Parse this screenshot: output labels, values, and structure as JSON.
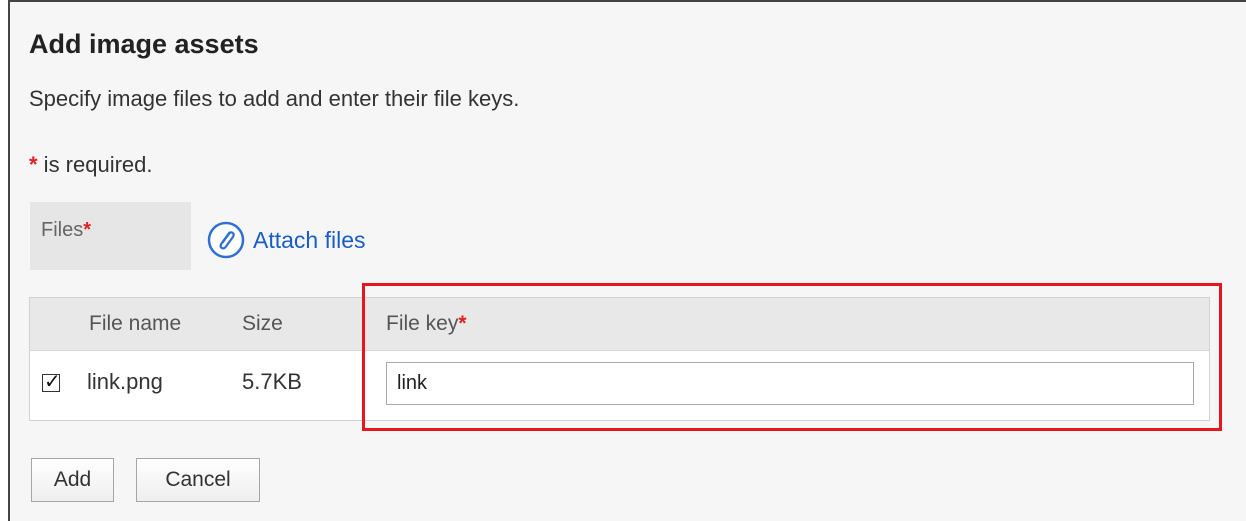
{
  "dialog": {
    "title": "Add image assets",
    "description": "Specify image files to add and enter their file keys.",
    "required_star": "*",
    "required_text": " is required."
  },
  "files_field": {
    "label": "Files",
    "required_star": "*",
    "attach_label": "Attach files",
    "icon": "paperclip-icon"
  },
  "table": {
    "headers": {
      "file_name": "File name",
      "size": "Size",
      "file_key": "File key",
      "file_key_required": "*"
    },
    "rows": [
      {
        "checked": true,
        "file_name": "link.png",
        "size": "5.7KB",
        "file_key": "link"
      }
    ]
  },
  "buttons": {
    "add": "Add",
    "cancel": "Cancel"
  },
  "colors": {
    "accent_link": "#1a5cc8",
    "required": "#e02020",
    "highlight": "#e8141e"
  }
}
